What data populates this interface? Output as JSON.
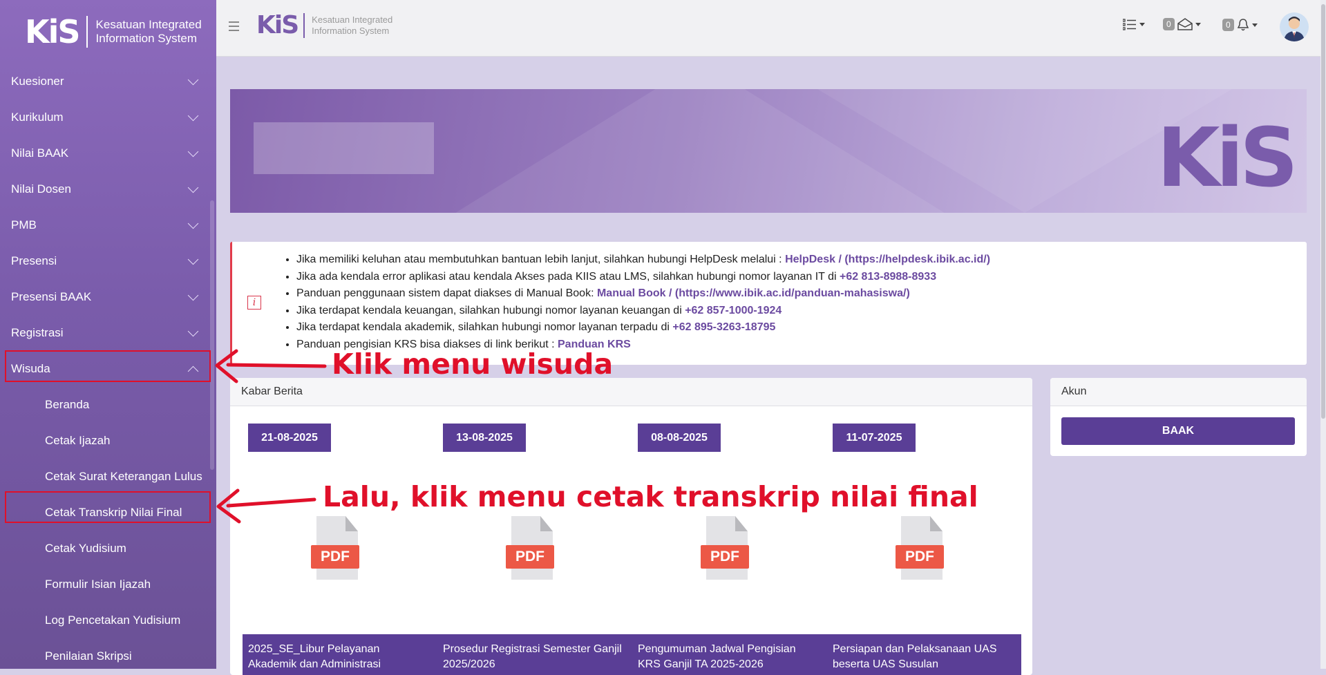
{
  "sidebar": {
    "logo_text": "KiS",
    "org_line1": "Kesatuan Integrated",
    "org_line2": "Information System",
    "menu": [
      {
        "label": "Kuesioner"
      },
      {
        "label": "Kurikulum"
      },
      {
        "label": "Nilai BAAK"
      },
      {
        "label": "Nilai Dosen"
      },
      {
        "label": "PMB"
      },
      {
        "label": "Presensi"
      },
      {
        "label": "Presensi BAAK"
      },
      {
        "label": "Registrasi"
      },
      {
        "label": "Wisuda"
      }
    ],
    "wisuda_submenu": [
      {
        "label": "Beranda"
      },
      {
        "label": "Cetak Ijazah"
      },
      {
        "label": "Cetak Surat Keterangan Lulus"
      },
      {
        "label": "Cetak Transkrip Nilai Final"
      },
      {
        "label": "Cetak Yudisium"
      },
      {
        "label": "Formulir Isian Ijazah"
      },
      {
        "label": "Log Pencetakan Yudisium"
      },
      {
        "label": "Penilaian Skripsi"
      }
    ]
  },
  "topbar": {
    "logo_text": "KiS",
    "org_line1": "Kesatuan Integrated",
    "org_line2": "Information System",
    "messages_count": "0",
    "notifications_count": "0"
  },
  "banner": {
    "logo_text": "KiS"
  },
  "info": {
    "items": [
      {
        "text": "Jika memiliki keluhan atau membutuhkan bantuan lebih lanjut, silahkan hubungi HelpDesk melalui : ",
        "link": "HelpDesk / (https://helpdesk.ibik.ac.id/)"
      },
      {
        "text": "Jika ada kendala error aplikasi atau kendala Akses pada KIIS atau LMS, silahkan hubungi nomor layanan IT di ",
        "link": "+62 813-8988-8933"
      },
      {
        "text": "Panduan penggunaan sistem dapat diakses di Manual Book: ",
        "link": "Manual Book / (https://www.ibik.ac.id/panduan-mahasiswa/)"
      },
      {
        "text": "Jika terdapat kendala keuangan, silahkan hubungi nomor layanan keuangan di ",
        "link": "+62 857-1000-1924"
      },
      {
        "text": "Jika terdapat kendala akademik, silahkan hubungi nomor layanan terpadu di ",
        "link": "+62 895-3263-18795"
      },
      {
        "text": "Panduan pengisian KRS bisa diakses di link berikut : ",
        "link": "Panduan KRS"
      }
    ]
  },
  "news": {
    "title": "Kabar Berita",
    "items": [
      {
        "date": "21-08-2025",
        "icon_label": "PDF",
        "title": "2025_SE_Libur Pelayanan Akademik dan Administrasi"
      },
      {
        "date": "13-08-2025",
        "icon_label": "PDF",
        "title": "Prosedur Registrasi Semester Ganjil 2025/2026"
      },
      {
        "date": "08-08-2025",
        "icon_label": "PDF",
        "title": "Pengumuman Jadwal Pengisian KRS Ganjil TA 2025-2026"
      },
      {
        "date": "11-07-2025",
        "icon_label": "PDF",
        "title": "Persiapan dan Pelaksanaan UAS beserta UAS Susulan"
      }
    ]
  },
  "akun": {
    "title": "Akun",
    "button": "BAAK"
  },
  "annotations": {
    "step1": "Klik menu wisuda",
    "step2": "Lalu, klik menu cetak transkrip nilai final"
  },
  "colors": {
    "accent": "#5a3e96",
    "sidebar": "#7a5cab",
    "annotation": "#e0102a"
  }
}
